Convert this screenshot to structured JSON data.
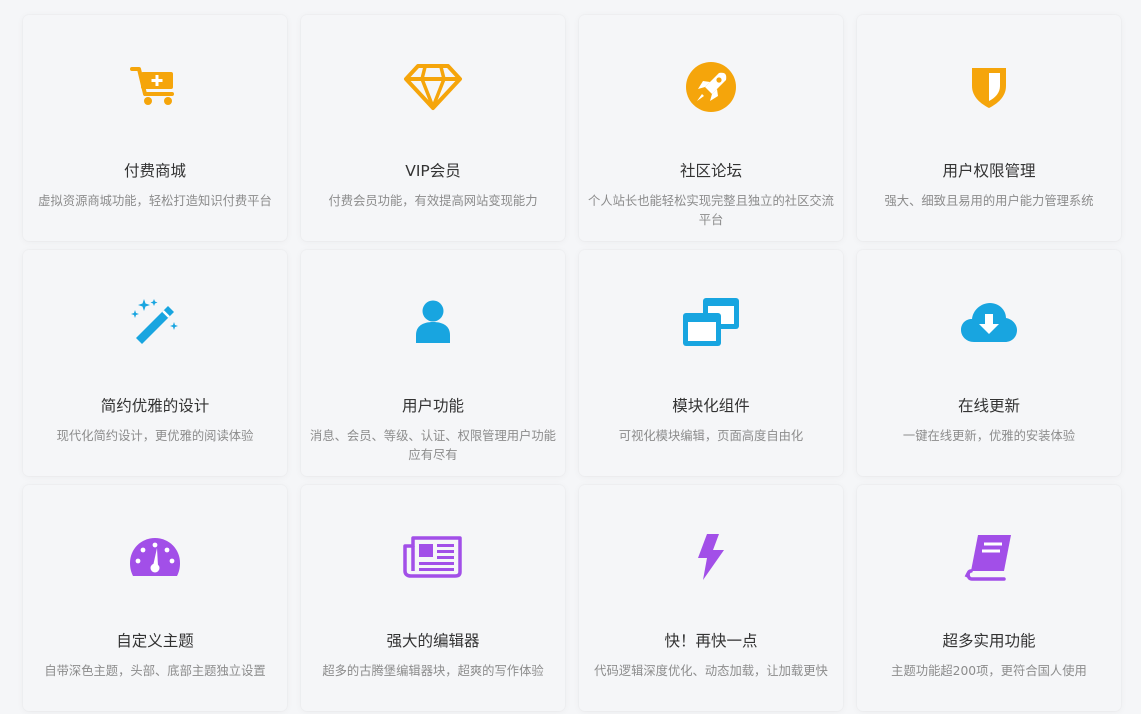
{
  "colors": {
    "row1": "#f5a50b",
    "row2": "#18a5e0",
    "row3": "#a24fe8"
  },
  "features": [
    {
      "icon": "shopping-cart-plus-icon",
      "title": "付费商城",
      "desc": "虚拟资源商城功能，轻松打造知识付费平台"
    },
    {
      "icon": "diamond-icon",
      "title": "VIP会员",
      "desc": "付费会员功能，有效提高网站变现能力"
    },
    {
      "icon": "rocket-circle-icon",
      "title": "社区论坛",
      "desc": "个人站长也能轻松实现完整且独立的社区交流平台"
    },
    {
      "icon": "shield-icon",
      "title": "用户权限管理",
      "desc": "强大、细致且易用的用户能力管理系统"
    },
    {
      "icon": "magic-wand-icon",
      "title": "简约优雅的设计",
      "desc": "现代化简约设计，更优雅的阅读体验"
    },
    {
      "icon": "user-icon",
      "title": "用户功能",
      "desc": "消息、会员、等级、认证、权限管理用户功能应有尽有"
    },
    {
      "icon": "windows-restore-icon",
      "title": "模块化组件",
      "desc": "可视化模块编辑，页面高度自由化"
    },
    {
      "icon": "cloud-download-icon",
      "title": "在线更新",
      "desc": "一键在线更新，优雅的安装体验"
    },
    {
      "icon": "dashboard-gauge-icon",
      "title": "自定义主题",
      "desc": "自带深色主题，头部、底部主题独立设置"
    },
    {
      "icon": "newspaper-icon",
      "title": "强大的编辑器",
      "desc": "超多的古腾堡编辑器块，超爽的写作体验"
    },
    {
      "icon": "lightning-bolt-icon",
      "title": "快！再快一点",
      "desc": "代码逻辑深度优化、动态加载，让加载更快"
    },
    {
      "icon": "book-icon",
      "title": "超多实用功能",
      "desc": "主题功能超200项，更符合国人使用"
    }
  ]
}
